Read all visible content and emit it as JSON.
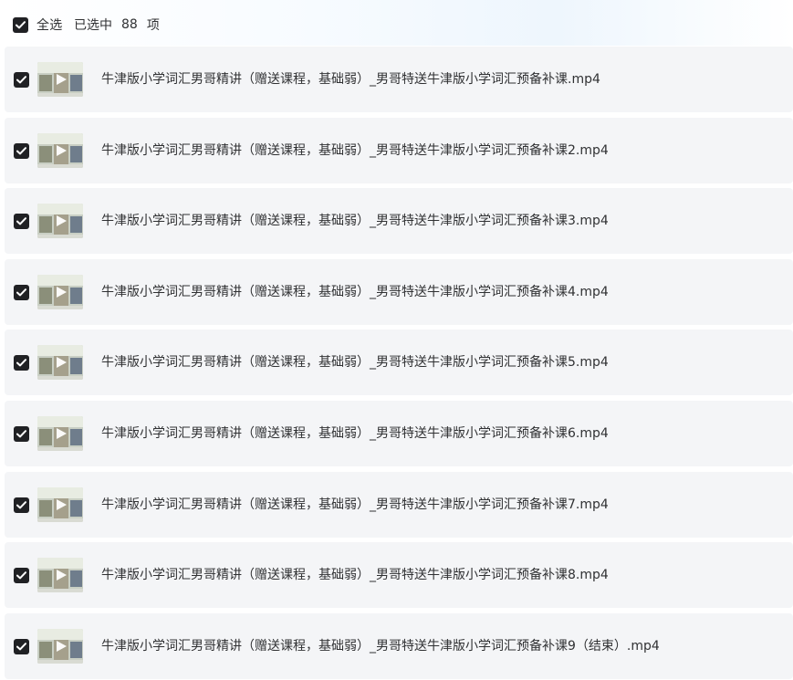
{
  "header": {
    "select_all_label": "全选",
    "selected_prefix": "已选中",
    "selected_count": "88",
    "selected_suffix": "项"
  },
  "files": [
    {
      "name": "牛津版小学词汇男哥精讲（赠送课程，基础弱）_男哥特送牛津版小学词汇预备补课.mp4",
      "checked": true
    },
    {
      "name": "牛津版小学词汇男哥精讲（赠送课程，基础弱）_男哥特送牛津版小学词汇预备补课2.mp4",
      "checked": true
    },
    {
      "name": "牛津版小学词汇男哥精讲（赠送课程，基础弱）_男哥特送牛津版小学词汇预备补课3.mp4",
      "checked": true
    },
    {
      "name": "牛津版小学词汇男哥精讲（赠送课程，基础弱）_男哥特送牛津版小学词汇预备补课4.mp4",
      "checked": true
    },
    {
      "name": "牛津版小学词汇男哥精讲（赠送课程，基础弱）_男哥特送牛津版小学词汇预备补课5.mp4",
      "checked": true
    },
    {
      "name": "牛津版小学词汇男哥精讲（赠送课程，基础弱）_男哥特送牛津版小学词汇预备补课6.mp4",
      "checked": true
    },
    {
      "name": "牛津版小学词汇男哥精讲（赠送课程，基础弱）_男哥特送牛津版小学词汇预备补课7.mp4",
      "checked": true
    },
    {
      "name": "牛津版小学词汇男哥精讲（赠送课程，基础弱）_男哥特送牛津版小学词汇预备补课8.mp4",
      "checked": true
    },
    {
      "name": "牛津版小学词汇男哥精讲（赠送课程，基础弱）_男哥特送牛津版小学词汇预备补课9（结束）.mp4",
      "checked": true
    }
  ],
  "icons": {
    "checkbox": "checkbox-checked-icon",
    "thumbnail": "video-thumbnail",
    "play": "play-icon"
  },
  "colors": {
    "checkbox_fill": "#202124",
    "row_background": "#f4f5f7",
    "text": "#303133"
  }
}
